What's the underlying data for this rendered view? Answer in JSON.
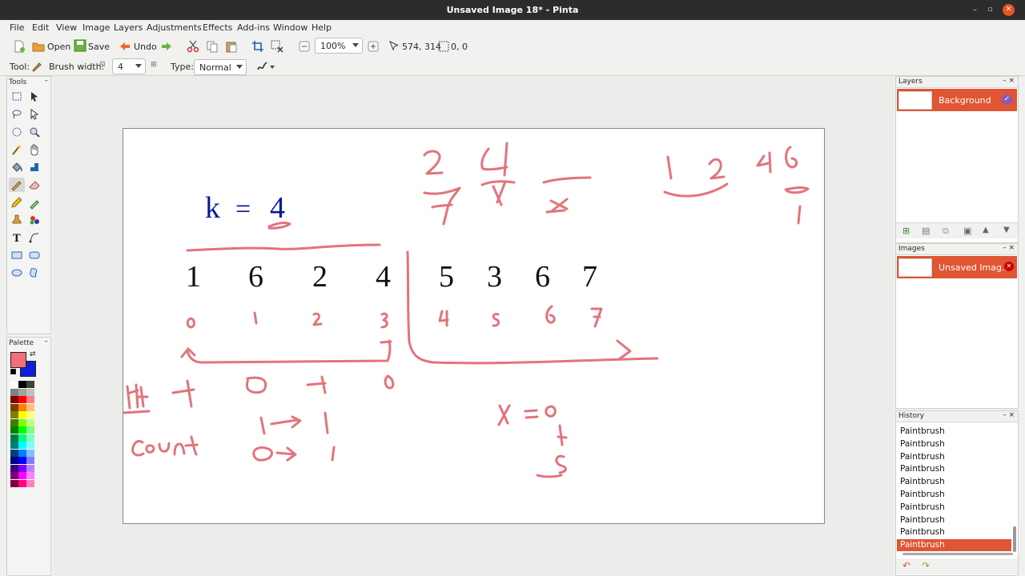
{
  "window": {
    "title": "Unsaved Image 18* - Pinta"
  },
  "menu": [
    "File",
    "Edit",
    "View",
    "Image",
    "Layers",
    "Adjustments",
    "Effects",
    "Add-ins",
    "Window",
    "Help"
  ],
  "toolbar": {
    "open_label": "Open",
    "save_label": "Save",
    "undo_label": "Undo",
    "zoom_value": "100%",
    "cursor_pos": "574, 314",
    "selection_size": "0, 0"
  },
  "tooloptions": {
    "tool_label": "Tool:",
    "brush_width_label": "Brush width:",
    "brush_width_value": "4",
    "type_label": "Type:",
    "type_value": "Normal"
  },
  "panels": {
    "tools_title": "Tools",
    "palette_title": "Palette",
    "layers_title": "Layers",
    "images_title": "Images",
    "history_title": "History"
  },
  "layers": [
    {
      "name": "Background",
      "visible": true
    }
  ],
  "images": [
    {
      "name": "Unsaved Imag..."
    }
  ],
  "history": [
    "Paintbrush",
    "Paintbrush",
    "Paintbrush",
    "Paintbrush",
    "Paintbrush",
    "Paintbrush",
    "Paintbrush",
    "Paintbrush",
    "Paintbrush",
    "Paintbrush"
  ],
  "canvas": {
    "k_label": "k",
    "k_equals": "=",
    "k_value": "4",
    "array": [
      "1",
      "6",
      "2",
      "4",
      "5",
      "3",
      "6",
      "7"
    ]
  },
  "colors": {
    "primary": "#f0707a",
    "secondary": "#1020d8",
    "accent": "#e05534",
    "ink": "#e2747c",
    "blue_text": "#0a1a9a"
  },
  "palette_colors": [
    "#ffffff",
    "#000000",
    "#404040",
    "#808080",
    "#a0a0a0",
    "#c0c0c0",
    "#7f0000",
    "#ff0000",
    "#ff8080",
    "#7f3f00",
    "#ff7f00",
    "#ffbf80",
    "#7f7f00",
    "#ffff00",
    "#ffff80",
    "#3f7f00",
    "#7fff00",
    "#bfff80",
    "#007f00",
    "#00ff00",
    "#80ff80",
    "#007f3f",
    "#00ff7f",
    "#80ffbf",
    "#007f7f",
    "#00ffff",
    "#80ffff",
    "#003f7f",
    "#007fff",
    "#80bfff",
    "#00007f",
    "#0000ff",
    "#8080ff",
    "#3f007f",
    "#7f00ff",
    "#bf80ff",
    "#7f007f",
    "#ff00ff",
    "#ff80ff",
    "#7f003f",
    "#ff007f",
    "#ff80bf"
  ]
}
